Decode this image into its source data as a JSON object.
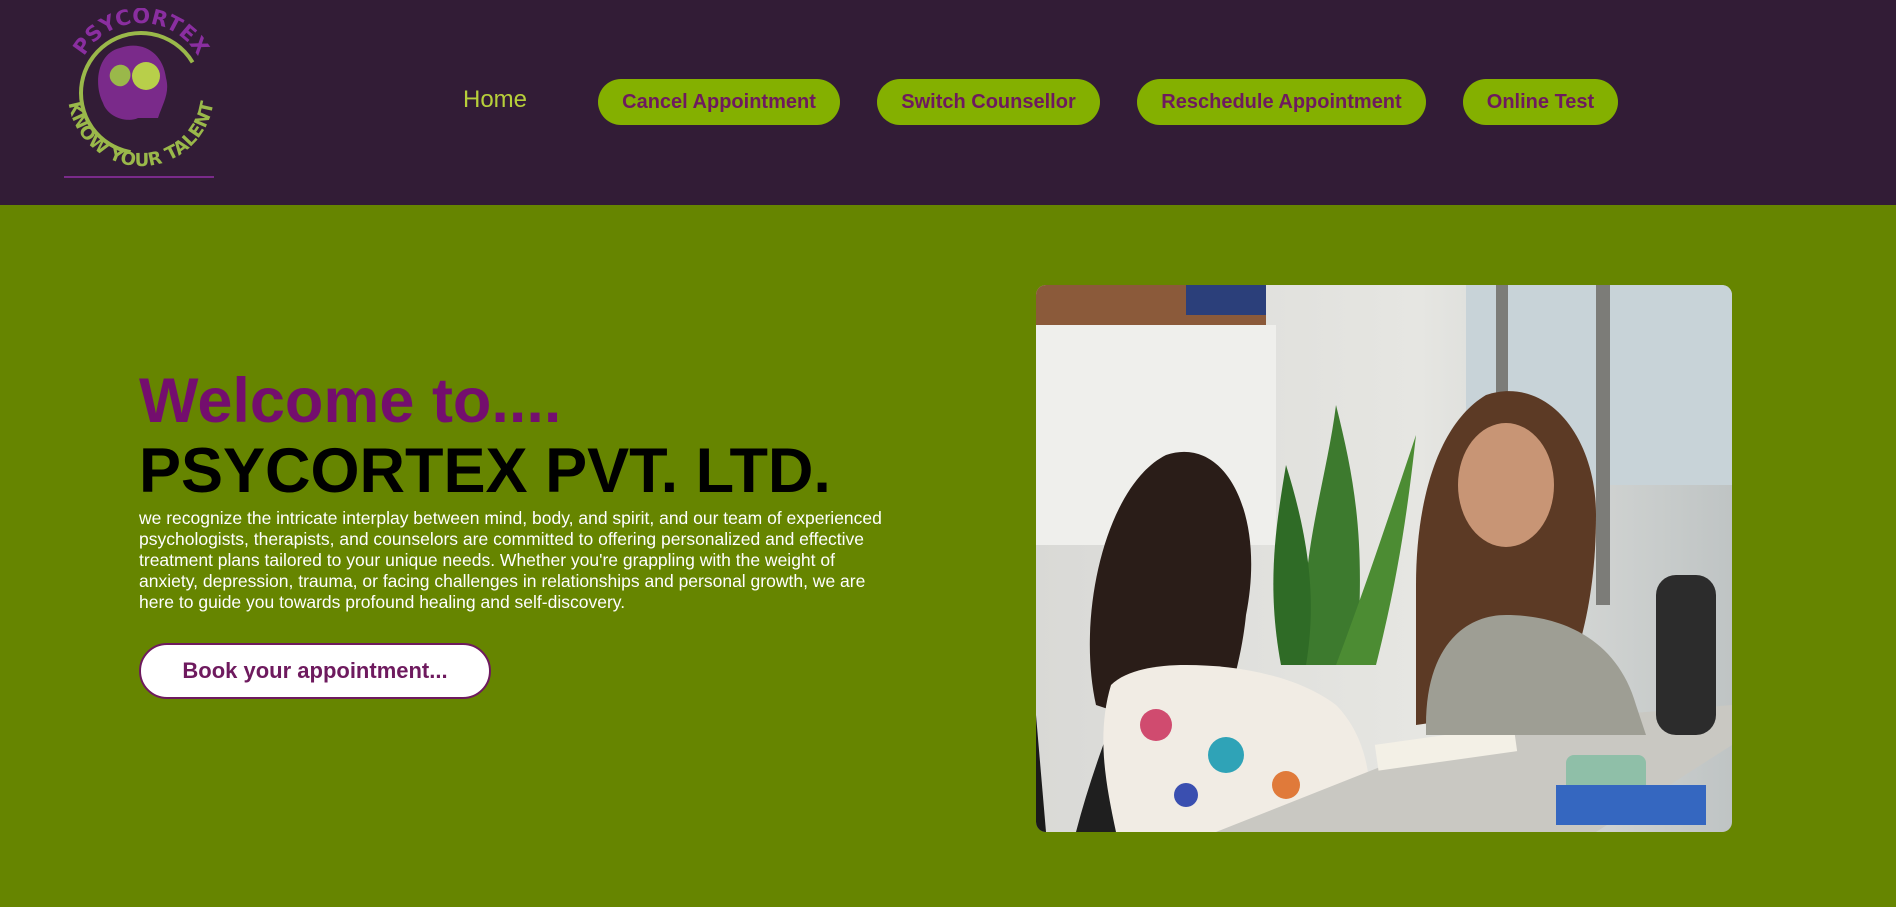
{
  "brand": {
    "logo_top_text": "PSYCORTEX",
    "logo_bottom_text": "KNOW YOUR TALENT",
    "colors": {
      "header_bg": "#321c36",
      "page_bg": "#668500",
      "accent_green": "#84b000",
      "accent_purple": "#740e6e"
    }
  },
  "nav": {
    "home": "Home",
    "buttons": [
      "Cancel Appointment",
      "Switch Counsellor",
      "Reschedule Appointment",
      "Online Test"
    ]
  },
  "hero": {
    "welcome": "Welcome to....",
    "company": "PSYCORTEX PVT. LTD.",
    "description": "we recognize the intricate interplay between mind, body, and spirit, and our team of experienced psychologists, therapists, and counselors are committed to offering personalized and effective treatment plans tailored to your unique needs. Whether you're grappling with the weight of anxiety, depression, trauma, or facing challenges in relationships and personal growth, we are here to guide you towards profound healing and self-discovery.",
    "cta": "Book your appointment..."
  },
  "image": {
    "icon": "counselling-session-photo"
  }
}
